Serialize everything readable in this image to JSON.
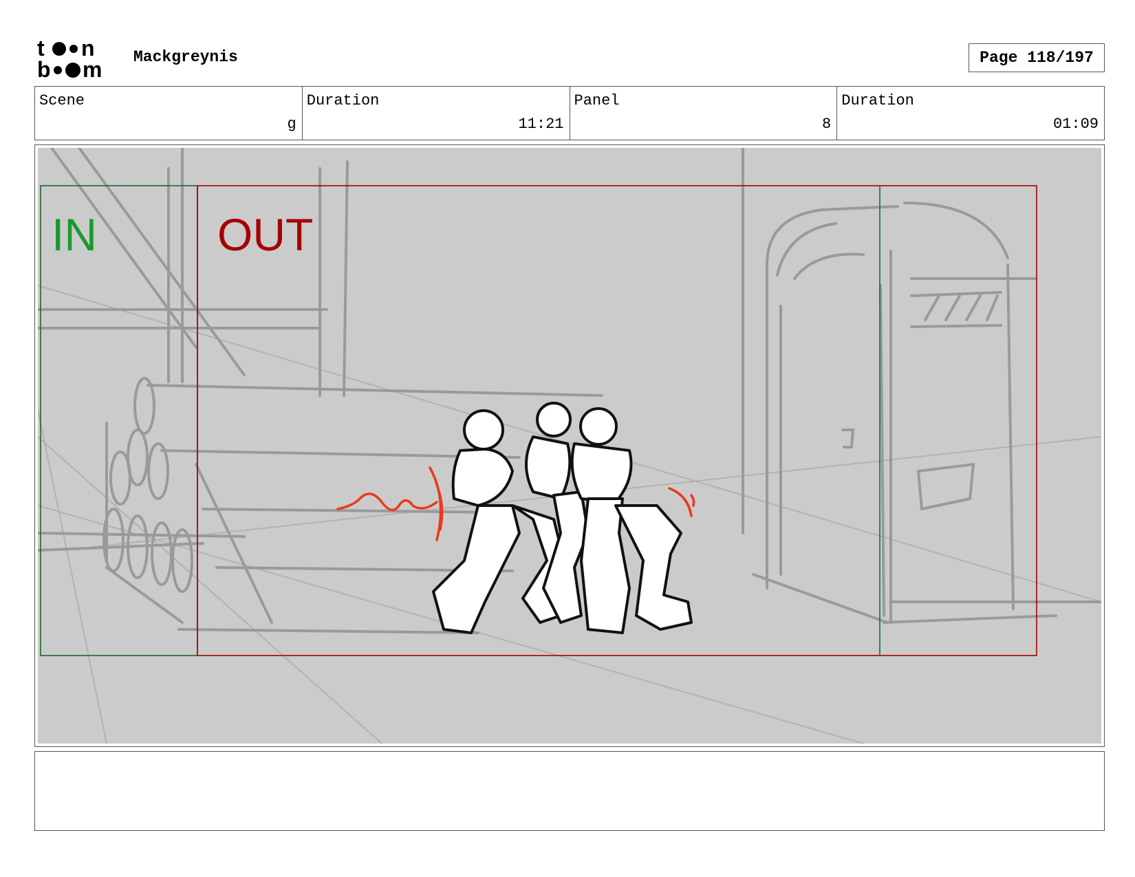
{
  "header": {
    "logo_text": "toon boom",
    "project_title": "Mackgreynis",
    "page_label": "Page 118/197"
  },
  "info": {
    "scene_label": "Scene",
    "scene_value": "g",
    "scene_duration_label": "Duration",
    "scene_duration_value": "11:21",
    "panel_label": "Panel",
    "panel_value": "8",
    "panel_duration_label": "Duration",
    "panel_duration_value": "01:09"
  },
  "panel": {
    "in_label": "IN",
    "out_label": "OUT"
  },
  "notes": {
    "text": ""
  },
  "colors": {
    "in_frame": "#1a9a2a",
    "out_frame": "#a40000",
    "sketch_bg": "#cbcbcb",
    "sketch_lines": "#9a9a9a",
    "action_lines": "#e83a1a"
  }
}
